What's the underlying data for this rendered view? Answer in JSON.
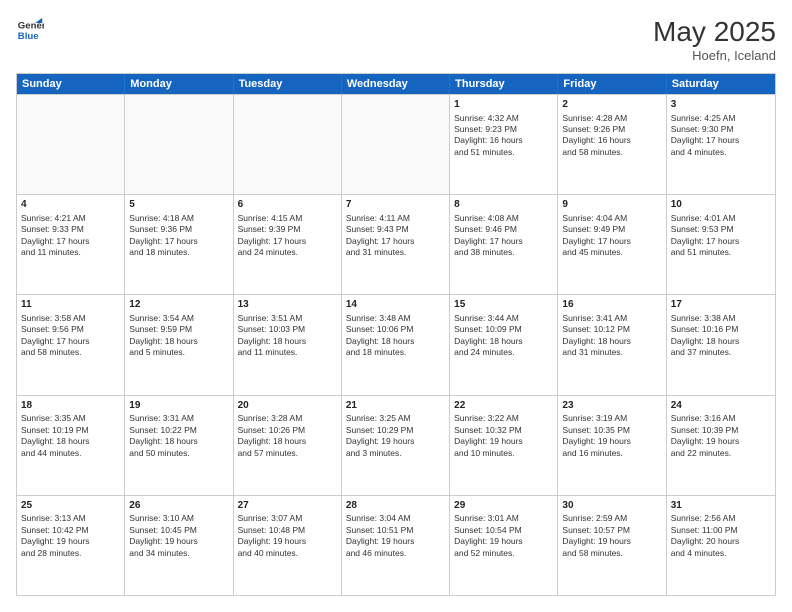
{
  "logo": {
    "general": "General",
    "blue": "Blue"
  },
  "header": {
    "month": "May 2025",
    "location": "Hoefn, Iceland"
  },
  "days_of_week": [
    "Sunday",
    "Monday",
    "Tuesday",
    "Wednesday",
    "Thursday",
    "Friday",
    "Saturday"
  ],
  "rows": [
    [
      {
        "day": "",
        "info": "",
        "empty": true
      },
      {
        "day": "",
        "info": "",
        "empty": true
      },
      {
        "day": "",
        "info": "",
        "empty": true
      },
      {
        "day": "",
        "info": "",
        "empty": true
      },
      {
        "day": "1",
        "info": "Sunrise: 4:32 AM\nSunset: 9:23 PM\nDaylight: 16 hours\nand 51 minutes."
      },
      {
        "day": "2",
        "info": "Sunrise: 4:28 AM\nSunset: 9:26 PM\nDaylight: 16 hours\nand 58 minutes."
      },
      {
        "day": "3",
        "info": "Sunrise: 4:25 AM\nSunset: 9:30 PM\nDaylight: 17 hours\nand 4 minutes."
      }
    ],
    [
      {
        "day": "4",
        "info": "Sunrise: 4:21 AM\nSunset: 9:33 PM\nDaylight: 17 hours\nand 11 minutes."
      },
      {
        "day": "5",
        "info": "Sunrise: 4:18 AM\nSunset: 9:36 PM\nDaylight: 17 hours\nand 18 minutes."
      },
      {
        "day": "6",
        "info": "Sunrise: 4:15 AM\nSunset: 9:39 PM\nDaylight: 17 hours\nand 24 minutes."
      },
      {
        "day": "7",
        "info": "Sunrise: 4:11 AM\nSunset: 9:43 PM\nDaylight: 17 hours\nand 31 minutes."
      },
      {
        "day": "8",
        "info": "Sunrise: 4:08 AM\nSunset: 9:46 PM\nDaylight: 17 hours\nand 38 minutes."
      },
      {
        "day": "9",
        "info": "Sunrise: 4:04 AM\nSunset: 9:49 PM\nDaylight: 17 hours\nand 45 minutes."
      },
      {
        "day": "10",
        "info": "Sunrise: 4:01 AM\nSunset: 9:53 PM\nDaylight: 17 hours\nand 51 minutes."
      }
    ],
    [
      {
        "day": "11",
        "info": "Sunrise: 3:58 AM\nSunset: 9:56 PM\nDaylight: 17 hours\nand 58 minutes."
      },
      {
        "day": "12",
        "info": "Sunrise: 3:54 AM\nSunset: 9:59 PM\nDaylight: 18 hours\nand 5 minutes."
      },
      {
        "day": "13",
        "info": "Sunrise: 3:51 AM\nSunset: 10:03 PM\nDaylight: 18 hours\nand 11 minutes."
      },
      {
        "day": "14",
        "info": "Sunrise: 3:48 AM\nSunset: 10:06 PM\nDaylight: 18 hours\nand 18 minutes."
      },
      {
        "day": "15",
        "info": "Sunrise: 3:44 AM\nSunset: 10:09 PM\nDaylight: 18 hours\nand 24 minutes."
      },
      {
        "day": "16",
        "info": "Sunrise: 3:41 AM\nSunset: 10:12 PM\nDaylight: 18 hours\nand 31 minutes."
      },
      {
        "day": "17",
        "info": "Sunrise: 3:38 AM\nSunset: 10:16 PM\nDaylight: 18 hours\nand 37 minutes."
      }
    ],
    [
      {
        "day": "18",
        "info": "Sunrise: 3:35 AM\nSunset: 10:19 PM\nDaylight: 18 hours\nand 44 minutes."
      },
      {
        "day": "19",
        "info": "Sunrise: 3:31 AM\nSunset: 10:22 PM\nDaylight: 18 hours\nand 50 minutes."
      },
      {
        "day": "20",
        "info": "Sunrise: 3:28 AM\nSunset: 10:26 PM\nDaylight: 18 hours\nand 57 minutes."
      },
      {
        "day": "21",
        "info": "Sunrise: 3:25 AM\nSunset: 10:29 PM\nDaylight: 19 hours\nand 3 minutes."
      },
      {
        "day": "22",
        "info": "Sunrise: 3:22 AM\nSunset: 10:32 PM\nDaylight: 19 hours\nand 10 minutes."
      },
      {
        "day": "23",
        "info": "Sunrise: 3:19 AM\nSunset: 10:35 PM\nDaylight: 19 hours\nand 16 minutes."
      },
      {
        "day": "24",
        "info": "Sunrise: 3:16 AM\nSunset: 10:39 PM\nDaylight: 19 hours\nand 22 minutes."
      }
    ],
    [
      {
        "day": "25",
        "info": "Sunrise: 3:13 AM\nSunset: 10:42 PM\nDaylight: 19 hours\nand 28 minutes."
      },
      {
        "day": "26",
        "info": "Sunrise: 3:10 AM\nSunset: 10:45 PM\nDaylight: 19 hours\nand 34 minutes."
      },
      {
        "day": "27",
        "info": "Sunrise: 3:07 AM\nSunset: 10:48 PM\nDaylight: 19 hours\nand 40 minutes."
      },
      {
        "day": "28",
        "info": "Sunrise: 3:04 AM\nSunset: 10:51 PM\nDaylight: 19 hours\nand 46 minutes."
      },
      {
        "day": "29",
        "info": "Sunrise: 3:01 AM\nSunset: 10:54 PM\nDaylight: 19 hours\nand 52 minutes."
      },
      {
        "day": "30",
        "info": "Sunrise: 2:59 AM\nSunset: 10:57 PM\nDaylight: 19 hours\nand 58 minutes."
      },
      {
        "day": "31",
        "info": "Sunrise: 2:56 AM\nSunset: 11:00 PM\nDaylight: 20 hours\nand 4 minutes."
      }
    ]
  ]
}
